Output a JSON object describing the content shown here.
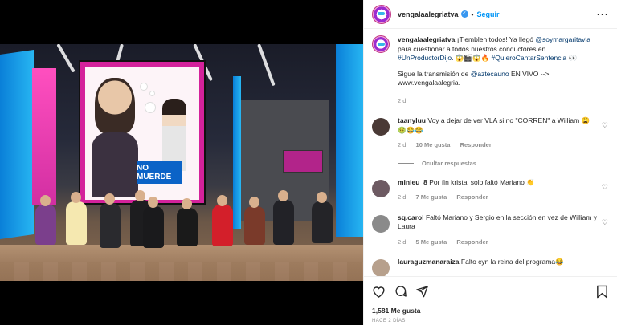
{
  "post": {
    "username": "vengalaalegriatva",
    "follow_label": "Seguir",
    "screen_caption": "NO MUERDE",
    "caption": {
      "username": "vengalaalegriatva",
      "part1": "¡Tiemblen todos! Ya llegó ",
      "mention1": "@soymargaritavla",
      "part2": " para cuestionar a todos nuestros conductores en ",
      "hashtag1": "#UnProductorDijo",
      "part3": ". 😱🎬😱🔥 ",
      "hashtag2": "#QuieroCantarSentencia",
      "part4": " 👀",
      "line2_a": "Sigue la transmisión de ",
      "mention2": "@aztecauno",
      "line2_b": " EN VIVO --> www.vengalaalegria.",
      "age": "2 d"
    },
    "comments": [
      {
        "user": "taanyluu",
        "text": "Voy a dejar de ver VLA si no \"CORREN\" a William 😩 🤢😂😂",
        "age": "2 d",
        "likes": "10 Me gusta",
        "reply": "Responder",
        "avatar_color": "#4a3a36"
      },
      {
        "user": "minieu_8",
        "text": "Por fin kristal solo faltó Mariano 👏",
        "age": "2 d",
        "likes": "7 Me gusta",
        "reply": "Responder",
        "avatar_color": "#6d5a62"
      },
      {
        "user": "sq.carol",
        "text": "Faltó Mariano y Sergio en la sección en vez de William y Laura",
        "age": "2 d",
        "likes": "5 Me gusta",
        "reply": "Responder",
        "avatar_color": "#8a8a8a"
      },
      {
        "user": "lauraguzmanaraiza",
        "text": "Falto cyn la reina del programa😂",
        "avatar_color": "#b7a08c"
      }
    ],
    "hide_replies": "Ocultar respuestas",
    "likes_count": "1,581 Me gusta",
    "timestamp": "HACE 2 DÍAS"
  },
  "icons": [
    "verified-icon",
    "more-options-icon",
    "heart-icon",
    "comment-icon",
    "share-icon",
    "save-icon"
  ]
}
